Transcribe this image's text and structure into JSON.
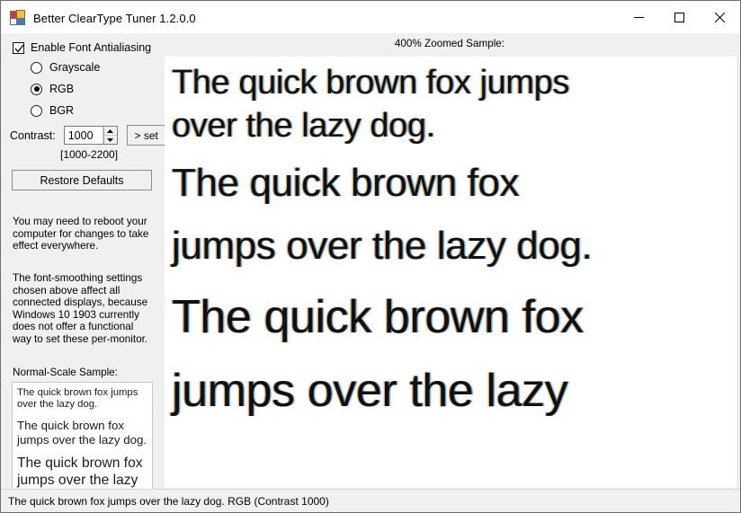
{
  "window": {
    "title": "Better ClearType Tuner 1.2.0.0",
    "app_icon": "window-grid-icon",
    "controls": {
      "minimize": "minimize-icon",
      "maximize": "maximize-icon",
      "close": "close-icon"
    }
  },
  "settings": {
    "enable_antialiasing": {
      "label": "Enable Font Antialiasing",
      "checked": true
    },
    "modes": [
      {
        "label": "Grayscale",
        "selected": false
      },
      {
        "label": "RGB",
        "selected": true
      },
      {
        "label": "BGR",
        "selected": false
      }
    ],
    "contrast": {
      "label": "Contrast:",
      "value": "1000",
      "placeholder": "1000",
      "set_button": "> set",
      "range_note": "[1000-2200]"
    },
    "restore_button": "Restore Defaults"
  },
  "notes": {
    "paragraph_1": "You may need to reboot your computer for changes to take effect everywhere.",
    "paragraph_2": "The font-smoothing settings chosen above affect all connected displays, because Windows 10 1903 currently does not offer a functional way to set these per-monitor."
  },
  "normal_sample": {
    "label": "Normal-Scale Sample:",
    "lines": [
      "The quick brown fox jumps over the lazy dog.",
      "The quick brown fox jumps over the lazy dog.",
      "The quick brown fox jumps over the lazy"
    ]
  },
  "zoom_sample": {
    "header": "400% Zoomed Sample:",
    "lines": [
      "The quick brown fox jumps",
      "over the lazy dog.",
      "The quick brown fox",
      "jumps over the lazy dog.",
      "The quick brown fox",
      "jumps over the lazy"
    ]
  },
  "statusbar": {
    "text": "The quick brown fox jumps over the lazy dog. RGB (Contrast 1000)"
  },
  "colors": {
    "window_background": "#f0f0f0",
    "titlebar_background": "#ffffff",
    "panel_background": "#ffffff",
    "text": "#000000",
    "border": "#6d6d6d"
  }
}
